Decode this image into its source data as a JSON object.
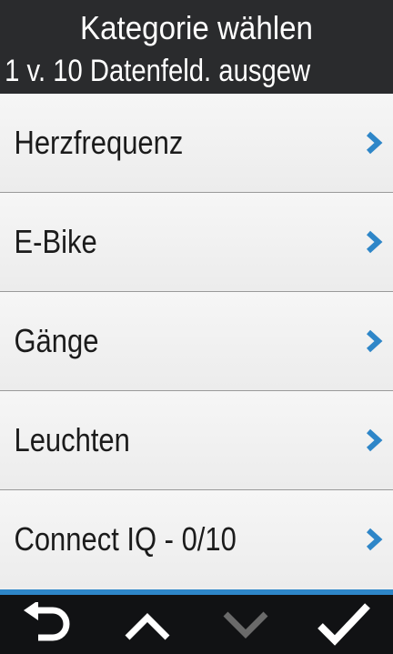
{
  "header": {
    "title": "Kategorie wählen",
    "subtitle": "1 v. 10 Datenfeld. ausgew"
  },
  "categories": [
    {
      "label": "Herzfrequenz"
    },
    {
      "label": "E-Bike"
    },
    {
      "label": "Gänge"
    },
    {
      "label": "Leuchten"
    },
    {
      "label": "Connect IQ - 0/10"
    }
  ],
  "icons": {
    "row_chevron": "chevron-right-icon",
    "back": "back-arrow-icon",
    "up": "chevron-up-icon",
    "down": "chevron-down-icon",
    "confirm": "checkmark-icon"
  },
  "colors": {
    "accent": "#2e86c8",
    "header_bg": "#2a2b2d",
    "bar_bg": "#111214",
    "disabled": "#6a6a6a"
  }
}
